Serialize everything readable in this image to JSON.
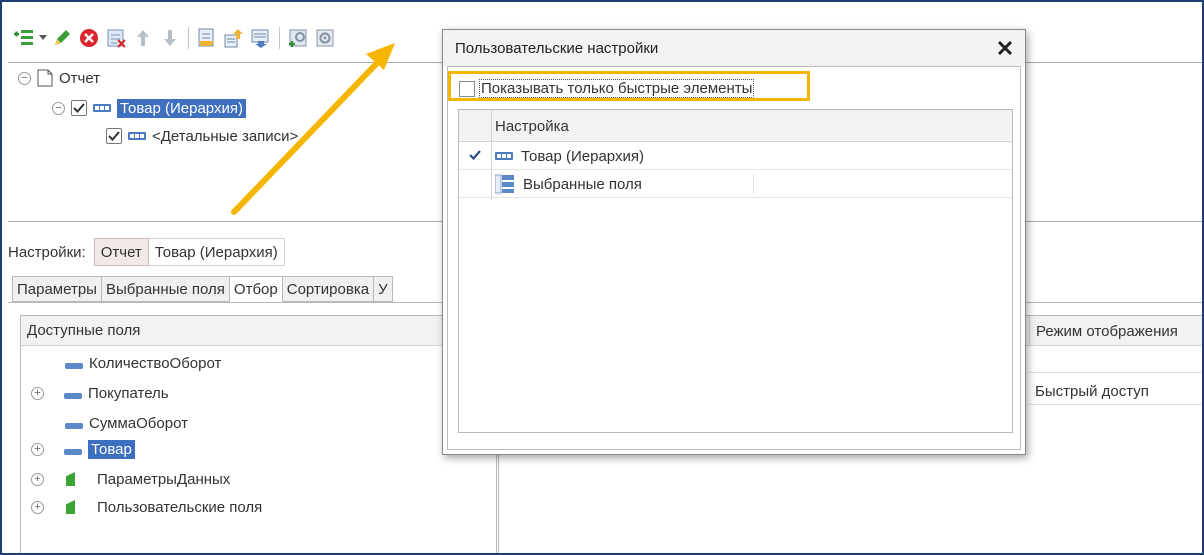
{
  "dialog": {
    "title": "Пользовательские настройки",
    "close_icon": "close-icon",
    "quick_only_label": "Показывать только быстрые элементы",
    "grid_header": "Настройка",
    "rows": [
      {
        "label": "Товар (Иерархия)",
        "checked": true,
        "icon": "grouping-icon"
      },
      {
        "label": "Выбранные поля",
        "checked": false,
        "icon": "selected-fields-icon"
      }
    ]
  },
  "toolbar": {
    "icons": [
      "add-icon",
      "edit-pencil-icon",
      "delete-icon",
      "clear-icon",
      "move-up-icon",
      "move-down-icon",
      "group-icon",
      "group-up-icon",
      "group-down-icon",
      "add-settings-icon",
      "user-settings-icon"
    ]
  },
  "tree": {
    "root_label": "Отчет",
    "group_label": "Товар (Иерархия)",
    "details_label": "<Детальные записи>"
  },
  "settings_bar": {
    "label": "Настройки:",
    "crumb_report": "Отчет",
    "crumb_group": "Товар (Иерархия)"
  },
  "tabs": [
    "Параметры",
    "Выбранные поля",
    "Отбор",
    "Сортировка",
    "У"
  ],
  "active_tab": "Отбор",
  "fields": {
    "header": "Доступные поля",
    "items": [
      {
        "label": "КоличествоОборот",
        "expandable": false,
        "kind": "field"
      },
      {
        "label": "Покупатель",
        "expandable": true,
        "kind": "field"
      },
      {
        "label": "СуммаОборот",
        "expandable": false,
        "kind": "field"
      },
      {
        "label": "Товар",
        "expandable": true,
        "kind": "field",
        "selected": true
      },
      {
        "label": "ПараметрыДанных",
        "expandable": true,
        "kind": "folder"
      },
      {
        "label": "Пользовательские поля",
        "expandable": true,
        "kind": "folder"
      }
    ]
  },
  "right_grid": {
    "mode_header": "Режим отображения",
    "mode_value": "Быстрый доступ"
  },
  "colors": {
    "highlight": "#f6b500",
    "arrow": "#f6b500",
    "selection": "#3f6fbf",
    "frame": "#1f3f74"
  }
}
